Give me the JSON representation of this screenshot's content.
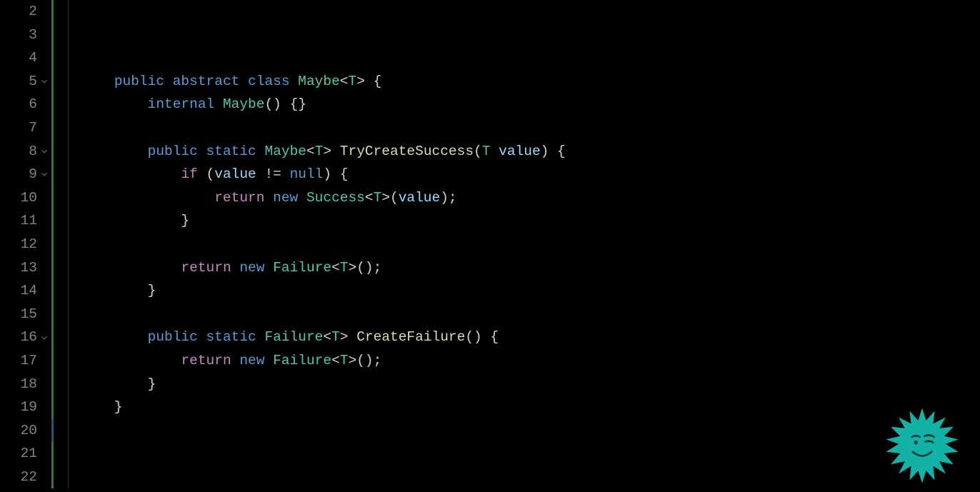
{
  "lines": [
    {
      "num": "2",
      "fold": false,
      "bar": "green",
      "tokens": []
    },
    {
      "num": "3",
      "fold": false,
      "bar": "green",
      "tokens": []
    },
    {
      "num": "4",
      "fold": false,
      "bar": "green",
      "tokens": []
    },
    {
      "num": "5",
      "fold": true,
      "bar": "green",
      "tokens": [
        {
          "t": "    ",
          "c": ""
        },
        {
          "t": "public ",
          "c": "tk-kw-blue"
        },
        {
          "t": "abstract ",
          "c": "tk-kw-blue"
        },
        {
          "t": "class ",
          "c": "tk-kw-blue"
        },
        {
          "t": "Maybe",
          "c": "tk-type"
        },
        {
          "t": "<",
          "c": "tk-punc"
        },
        {
          "t": "T",
          "c": "tk-type"
        },
        {
          "t": "> {",
          "c": "tk-punc"
        }
      ]
    },
    {
      "num": "6",
      "fold": false,
      "bar": "green",
      "tokens": [
        {
          "t": "        ",
          "c": ""
        },
        {
          "t": "internal ",
          "c": "tk-kw-blue"
        },
        {
          "t": "Maybe",
          "c": "tk-type"
        },
        {
          "t": "() {}",
          "c": "tk-punc"
        }
      ]
    },
    {
      "num": "7",
      "fold": false,
      "bar": "green",
      "tokens": []
    },
    {
      "num": "8",
      "fold": true,
      "bar": "green",
      "tokens": [
        {
          "t": "        ",
          "c": ""
        },
        {
          "t": "public ",
          "c": "tk-kw-blue"
        },
        {
          "t": "static ",
          "c": "tk-kw-blue"
        },
        {
          "t": "Maybe",
          "c": "tk-type"
        },
        {
          "t": "<",
          "c": "tk-punc"
        },
        {
          "t": "T",
          "c": "tk-type"
        },
        {
          "t": "> ",
          "c": "tk-punc"
        },
        {
          "t": "TryCreateSuccess",
          "c": "tk-func"
        },
        {
          "t": "(",
          "c": "tk-punc"
        },
        {
          "t": "T ",
          "c": "tk-type"
        },
        {
          "t": "value",
          "c": "tk-var"
        },
        {
          "t": ") {",
          "c": "tk-punc"
        }
      ]
    },
    {
      "num": "9",
      "fold": true,
      "bar": "green",
      "tokens": [
        {
          "t": "            ",
          "c": ""
        },
        {
          "t": "if ",
          "c": "tk-kw-pink"
        },
        {
          "t": "(",
          "c": "tk-punc"
        },
        {
          "t": "value ",
          "c": "tk-var"
        },
        {
          "t": "!= ",
          "c": "tk-punc"
        },
        {
          "t": "null",
          "c": "tk-null"
        },
        {
          "t": ") {",
          "c": "tk-punc"
        }
      ]
    },
    {
      "num": "10",
      "fold": false,
      "bar": "green",
      "tokens": [
        {
          "t": "                ",
          "c": ""
        },
        {
          "t": "return ",
          "c": "tk-kw-pink"
        },
        {
          "t": "new ",
          "c": "tk-new"
        },
        {
          "t": "Success",
          "c": "tk-type"
        },
        {
          "t": "<",
          "c": "tk-punc"
        },
        {
          "t": "T",
          "c": "tk-type"
        },
        {
          "t": ">(",
          "c": "tk-punc"
        },
        {
          "t": "value",
          "c": "tk-var"
        },
        {
          "t": ");",
          "c": "tk-punc"
        }
      ]
    },
    {
      "num": "11",
      "fold": false,
      "bar": "green",
      "tokens": [
        {
          "t": "            }",
          "c": "tk-punc"
        }
      ]
    },
    {
      "num": "12",
      "fold": false,
      "bar": "green",
      "tokens": []
    },
    {
      "num": "13",
      "fold": false,
      "bar": "green",
      "tokens": [
        {
          "t": "            ",
          "c": ""
        },
        {
          "t": "return ",
          "c": "tk-kw-pink"
        },
        {
          "t": "new ",
          "c": "tk-new"
        },
        {
          "t": "Failure",
          "c": "tk-type"
        },
        {
          "t": "<",
          "c": "tk-punc"
        },
        {
          "t": "T",
          "c": "tk-type"
        },
        {
          "t": ">();",
          "c": "tk-punc"
        }
      ]
    },
    {
      "num": "14",
      "fold": false,
      "bar": "green",
      "tokens": [
        {
          "t": "        }",
          "c": "tk-punc"
        }
      ]
    },
    {
      "num": "15",
      "fold": false,
      "bar": "green",
      "tokens": []
    },
    {
      "num": "16",
      "fold": true,
      "bar": "green",
      "tokens": [
        {
          "t": "        ",
          "c": ""
        },
        {
          "t": "public ",
          "c": "tk-kw-blue"
        },
        {
          "t": "static ",
          "c": "tk-kw-blue"
        },
        {
          "t": "Failure",
          "c": "tk-type"
        },
        {
          "t": "<",
          "c": "tk-punc"
        },
        {
          "t": "T",
          "c": "tk-type"
        },
        {
          "t": "> ",
          "c": "tk-punc"
        },
        {
          "t": "CreateFailure",
          "c": "tk-func"
        },
        {
          "t": "() {",
          "c": "tk-punc"
        }
      ]
    },
    {
      "num": "17",
      "fold": false,
      "bar": "green",
      "tokens": [
        {
          "t": "            ",
          "c": ""
        },
        {
          "t": "return ",
          "c": "tk-kw-pink"
        },
        {
          "t": "new ",
          "c": "tk-new"
        },
        {
          "t": "Failure",
          "c": "tk-type"
        },
        {
          "t": "<",
          "c": "tk-punc"
        },
        {
          "t": "T",
          "c": "tk-type"
        },
        {
          "t": ">();",
          "c": "tk-punc"
        }
      ]
    },
    {
      "num": "18",
      "fold": false,
      "bar": "green",
      "tokens": [
        {
          "t": "        }",
          "c": "tk-punc"
        }
      ]
    },
    {
      "num": "19",
      "fold": false,
      "bar": "green",
      "tokens": [
        {
          "t": "    }",
          "c": "tk-punc"
        }
      ]
    },
    {
      "num": "20",
      "fold": false,
      "bar": "blue",
      "tokens": []
    },
    {
      "num": "21",
      "fold": false,
      "bar": "green",
      "tokens": []
    },
    {
      "num": "22",
      "fold": false,
      "bar": "green",
      "tokens": []
    }
  ]
}
